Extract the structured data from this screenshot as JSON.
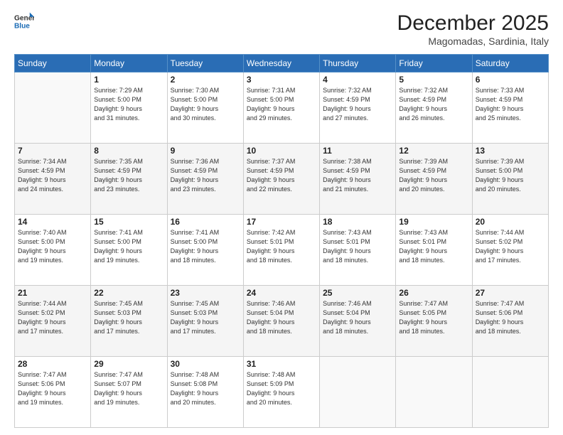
{
  "header": {
    "logo_line1": "General",
    "logo_line2": "Blue",
    "month": "December 2025",
    "location": "Magomadas, Sardinia, Italy"
  },
  "weekdays": [
    "Sunday",
    "Monday",
    "Tuesday",
    "Wednesday",
    "Thursday",
    "Friday",
    "Saturday"
  ],
  "weeks": [
    [
      {
        "day": "",
        "info": ""
      },
      {
        "day": "1",
        "info": "Sunrise: 7:29 AM\nSunset: 5:00 PM\nDaylight: 9 hours\nand 31 minutes."
      },
      {
        "day": "2",
        "info": "Sunrise: 7:30 AM\nSunset: 5:00 PM\nDaylight: 9 hours\nand 30 minutes."
      },
      {
        "day": "3",
        "info": "Sunrise: 7:31 AM\nSunset: 5:00 PM\nDaylight: 9 hours\nand 29 minutes."
      },
      {
        "day": "4",
        "info": "Sunrise: 7:32 AM\nSunset: 4:59 PM\nDaylight: 9 hours\nand 27 minutes."
      },
      {
        "day": "5",
        "info": "Sunrise: 7:32 AM\nSunset: 4:59 PM\nDaylight: 9 hours\nand 26 minutes."
      },
      {
        "day": "6",
        "info": "Sunrise: 7:33 AM\nSunset: 4:59 PM\nDaylight: 9 hours\nand 25 minutes."
      }
    ],
    [
      {
        "day": "7",
        "info": "Sunrise: 7:34 AM\nSunset: 4:59 PM\nDaylight: 9 hours\nand 24 minutes."
      },
      {
        "day": "8",
        "info": "Sunrise: 7:35 AM\nSunset: 4:59 PM\nDaylight: 9 hours\nand 23 minutes."
      },
      {
        "day": "9",
        "info": "Sunrise: 7:36 AM\nSunset: 4:59 PM\nDaylight: 9 hours\nand 23 minutes."
      },
      {
        "day": "10",
        "info": "Sunrise: 7:37 AM\nSunset: 4:59 PM\nDaylight: 9 hours\nand 22 minutes."
      },
      {
        "day": "11",
        "info": "Sunrise: 7:38 AM\nSunset: 4:59 PM\nDaylight: 9 hours\nand 21 minutes."
      },
      {
        "day": "12",
        "info": "Sunrise: 7:39 AM\nSunset: 4:59 PM\nDaylight: 9 hours\nand 20 minutes."
      },
      {
        "day": "13",
        "info": "Sunrise: 7:39 AM\nSunset: 5:00 PM\nDaylight: 9 hours\nand 20 minutes."
      }
    ],
    [
      {
        "day": "14",
        "info": "Sunrise: 7:40 AM\nSunset: 5:00 PM\nDaylight: 9 hours\nand 19 minutes."
      },
      {
        "day": "15",
        "info": "Sunrise: 7:41 AM\nSunset: 5:00 PM\nDaylight: 9 hours\nand 19 minutes."
      },
      {
        "day": "16",
        "info": "Sunrise: 7:41 AM\nSunset: 5:00 PM\nDaylight: 9 hours\nand 18 minutes."
      },
      {
        "day": "17",
        "info": "Sunrise: 7:42 AM\nSunset: 5:01 PM\nDaylight: 9 hours\nand 18 minutes."
      },
      {
        "day": "18",
        "info": "Sunrise: 7:43 AM\nSunset: 5:01 PM\nDaylight: 9 hours\nand 18 minutes."
      },
      {
        "day": "19",
        "info": "Sunrise: 7:43 AM\nSunset: 5:01 PM\nDaylight: 9 hours\nand 18 minutes."
      },
      {
        "day": "20",
        "info": "Sunrise: 7:44 AM\nSunset: 5:02 PM\nDaylight: 9 hours\nand 17 minutes."
      }
    ],
    [
      {
        "day": "21",
        "info": "Sunrise: 7:44 AM\nSunset: 5:02 PM\nDaylight: 9 hours\nand 17 minutes."
      },
      {
        "day": "22",
        "info": "Sunrise: 7:45 AM\nSunset: 5:03 PM\nDaylight: 9 hours\nand 17 minutes."
      },
      {
        "day": "23",
        "info": "Sunrise: 7:45 AM\nSunset: 5:03 PM\nDaylight: 9 hours\nand 17 minutes."
      },
      {
        "day": "24",
        "info": "Sunrise: 7:46 AM\nSunset: 5:04 PM\nDaylight: 9 hours\nand 18 minutes."
      },
      {
        "day": "25",
        "info": "Sunrise: 7:46 AM\nSunset: 5:04 PM\nDaylight: 9 hours\nand 18 minutes."
      },
      {
        "day": "26",
        "info": "Sunrise: 7:47 AM\nSunset: 5:05 PM\nDaylight: 9 hours\nand 18 minutes."
      },
      {
        "day": "27",
        "info": "Sunrise: 7:47 AM\nSunset: 5:06 PM\nDaylight: 9 hours\nand 18 minutes."
      }
    ],
    [
      {
        "day": "28",
        "info": "Sunrise: 7:47 AM\nSunset: 5:06 PM\nDaylight: 9 hours\nand 19 minutes."
      },
      {
        "day": "29",
        "info": "Sunrise: 7:47 AM\nSunset: 5:07 PM\nDaylight: 9 hours\nand 19 minutes."
      },
      {
        "day": "30",
        "info": "Sunrise: 7:48 AM\nSunset: 5:08 PM\nDaylight: 9 hours\nand 20 minutes."
      },
      {
        "day": "31",
        "info": "Sunrise: 7:48 AM\nSunset: 5:09 PM\nDaylight: 9 hours\nand 20 minutes."
      },
      {
        "day": "",
        "info": ""
      },
      {
        "day": "",
        "info": ""
      },
      {
        "day": "",
        "info": ""
      }
    ]
  ]
}
